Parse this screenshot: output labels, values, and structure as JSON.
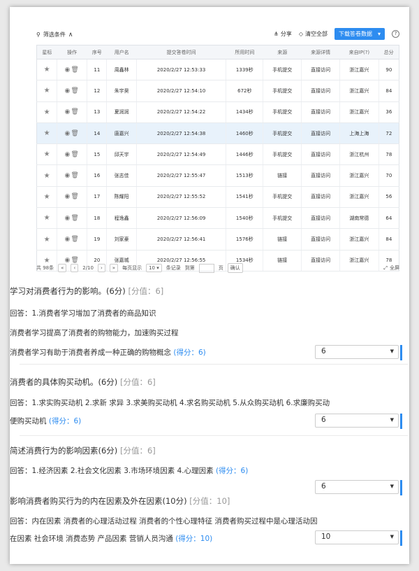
{
  "toolbar": {
    "filter_label": "筛选条件",
    "share_label": "分享",
    "clear_label": "清空全部",
    "download_label": "下载答卷数据"
  },
  "table": {
    "headers": [
      "星标",
      "操作",
      "序号",
      "用户名",
      "提交答卷时间",
      "所用时间",
      "来源",
      "来源详情",
      "来自IP(?)",
      "总分"
    ],
    "rows": [
      {
        "seq": "11",
        "user": "周鑫林",
        "time": "2020/2/27 12:53:33",
        "dur": "1339秒",
        "src": "手机提交",
        "detail": "直接访问",
        "ip": "浙江嘉兴",
        "score": "90"
      },
      {
        "seq": "12",
        "user": "朱宇昊",
        "time": "2020/2/27 12:54:10",
        "dur": "672秒",
        "src": "手机提交",
        "detail": "直接访问",
        "ip": "浙江嘉兴",
        "score": "84"
      },
      {
        "seq": "13",
        "user": "夏润润",
        "time": "2020/2/27 12:54:22",
        "dur": "1434秒",
        "src": "手机提交",
        "detail": "直接访问",
        "ip": "浙江嘉兴",
        "score": "36"
      },
      {
        "seq": "14",
        "user": "唐嘉兴",
        "time": "2020/2/27 12:54:38",
        "dur": "1460秒",
        "src": "手机提交",
        "detail": "直接访问",
        "ip": "上海上海",
        "score": "72"
      },
      {
        "seq": "15",
        "user": "邱天宇",
        "time": "2020/2/27 12:54:49",
        "dur": "1446秒",
        "src": "手机提交",
        "detail": "直接访问",
        "ip": "浙江杭州",
        "score": "78"
      },
      {
        "seq": "16",
        "user": "张志佳",
        "time": "2020/2/27 12:55:47",
        "dur": "1513秒",
        "src": "链接",
        "detail": "直接访问",
        "ip": "浙江嘉兴",
        "score": "70"
      },
      {
        "seq": "17",
        "user": "陈耀阳",
        "time": "2020/2/27 12:55:52",
        "dur": "1541秒",
        "src": "手机提交",
        "detail": "直接访问",
        "ip": "浙江嘉兴",
        "score": "56"
      },
      {
        "seq": "18",
        "user": "程逸鑫",
        "time": "2020/2/27 12:56:09",
        "dur": "1540秒",
        "src": "手机提交",
        "detail": "直接访问",
        "ip": "湖南常德",
        "score": "64"
      },
      {
        "seq": "19",
        "user": "刘家豪",
        "time": "2020/2/27 12:56:41",
        "dur": "1576秒",
        "src": "链接",
        "detail": "直接访问",
        "ip": "浙江嘉兴",
        "score": "84"
      },
      {
        "seq": "20",
        "user": "张嘉城",
        "time": "2020/2/27 12:56:55",
        "dur": "1534秒",
        "src": "链接",
        "detail": "直接访问",
        "ip": "浙江嘉兴",
        "score": "78"
      }
    ]
  },
  "pager": {
    "total": "共 98条",
    "page": "2/10",
    "per_page_label": "每页显示",
    "per_page": "10",
    "records_label": "条记录",
    "goto_label": "到第",
    "page_unit": "页",
    "confirm": "确认",
    "fullscreen": "全屏"
  },
  "questions": [
    {
      "title": "学习对消费者行为的影响。(6分)",
      "score_label": "[分值：6]",
      "answers": [
        "回答：1.消费者学习增加了消费者的商品知识",
        "消费者学习提高了消费者的购物能力，加速购买过程",
        "消费者学习有助于消费者养成一种正确的购物概念"
      ],
      "gain": "(得分：6)",
      "select": "6"
    },
    {
      "title": "消费者的具体购买动机。(6分)",
      "score_label": "[分值：6]",
      "answers": [
        "回答：1.求实购买动机 2.求新 求异 3.求美购买动机 4.求名购买动机 5.从众购买动机 6.求廉购买动",
        "便购买动机"
      ],
      "gain": "(得分：6)",
      "select": "6"
    },
    {
      "title": "简述消费行为的影响因素(6分)",
      "score_label": "[分值：6]",
      "answers": [
        "回答：1.经济因素 2.社会文化因素 3.市场环境因素 4.心理因素"
      ],
      "gain": "(得分：6)",
      "select": "6"
    },
    {
      "title": "影响消费者购买行为的内在因素及外在因素(10分)",
      "score_label": "[分值：10]",
      "answers": [
        "回答：内在因素 消费者的心理活动过程 消费者的个性心理特征 消费者购买过程中是心理活动因",
        "在因素 社会环境 消费态势 产品因素 营销人员沟通"
      ],
      "gain": "(得分：10)",
      "select": "10"
    }
  ]
}
